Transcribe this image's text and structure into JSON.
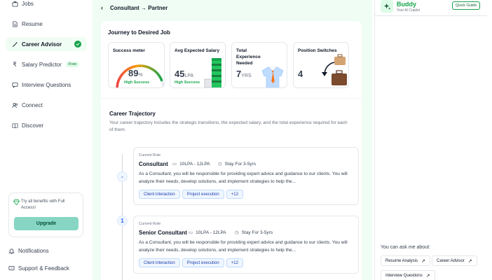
{
  "sidebar": {
    "items": [
      {
        "label": "Jobs",
        "icon": "briefcase-icon"
      },
      {
        "label": "Resume",
        "icon": "document-icon"
      },
      {
        "label": "Career Advisor",
        "icon": "wand-icon",
        "active": true
      },
      {
        "label": "Salary Predictor",
        "icon": "rupee-icon",
        "badge": "Free"
      },
      {
        "label": "Interview Questions",
        "icon": "chat-icon"
      },
      {
        "label": "Connect",
        "icon": "users-icon"
      },
      {
        "label": "Discover",
        "icon": "book-icon"
      }
    ],
    "upgrade": {
      "text": "Try all benefits with Full Access!",
      "button": "Upgrade"
    },
    "bottom": [
      {
        "label": "Notifications",
        "icon": "bell-icon"
      },
      {
        "label": "Support & Feedback",
        "icon": "help-icon"
      }
    ]
  },
  "topbar": {
    "title": "Consultant → Partner"
  },
  "journey": {
    "title": "Journey to Desired Job",
    "stats": [
      {
        "label": "Success meter",
        "value": "89",
        "unit": "%",
        "sub": "High Success",
        "fraction": 0.89
      },
      {
        "label": "Avg Expected Salary",
        "value": "45",
        "unit": "LPA",
        "sub": "High Success"
      },
      {
        "label": "Total Experience Needed",
        "value": "7",
        "unit": "YRS",
        "sub": ""
      },
      {
        "label": "Position Switches",
        "value": "4",
        "unit": "",
        "sub": ""
      }
    ]
  },
  "trajectory": {
    "title": "Career Trajectory",
    "description": "Your career trajectory includes the strategic transitions, the expected salary, and the total experience required for each of them.",
    "roles": [
      {
        "step": "-",
        "current_label": "Current Role",
        "name": "Consultant",
        "salary": "10LPA - 12LPA",
        "stay": "Stay For 3-5yrs",
        "body": "As a Consultant, you will be responsible for providing expert advice and guidance to our clients. You will analyze their needs, develop solutions, and implement strategies to help the...",
        "tags": [
          "Client interaction",
          "Project execution",
          "+12"
        ]
      },
      {
        "step": "1",
        "current_label": "Current Role",
        "name": "Senior Consultant",
        "salary": "10LPA - 12LPA",
        "stay": "Stay For 3-5yrs",
        "body": "As a Consultant, you will be responsible for providing expert advice and guidance to our clients. You will analyze their needs, develop solutions, and implement strategies to help the...",
        "tags": [
          "Client interaction",
          "Project execution",
          "+12"
        ]
      }
    ]
  },
  "buddy": {
    "name": "Buddy",
    "subtitle": "Your AI Copilot",
    "guide_button": "Quick Guide",
    "ask_label": "You can ask me about:",
    "chips": [
      "Resume Analysis",
      "Career Advisor",
      "Interview Questions"
    ]
  },
  "colors": {
    "accent": "#16a34a",
    "main_bg": "#f0fdf4",
    "tag_blue": "#1e40af"
  }
}
